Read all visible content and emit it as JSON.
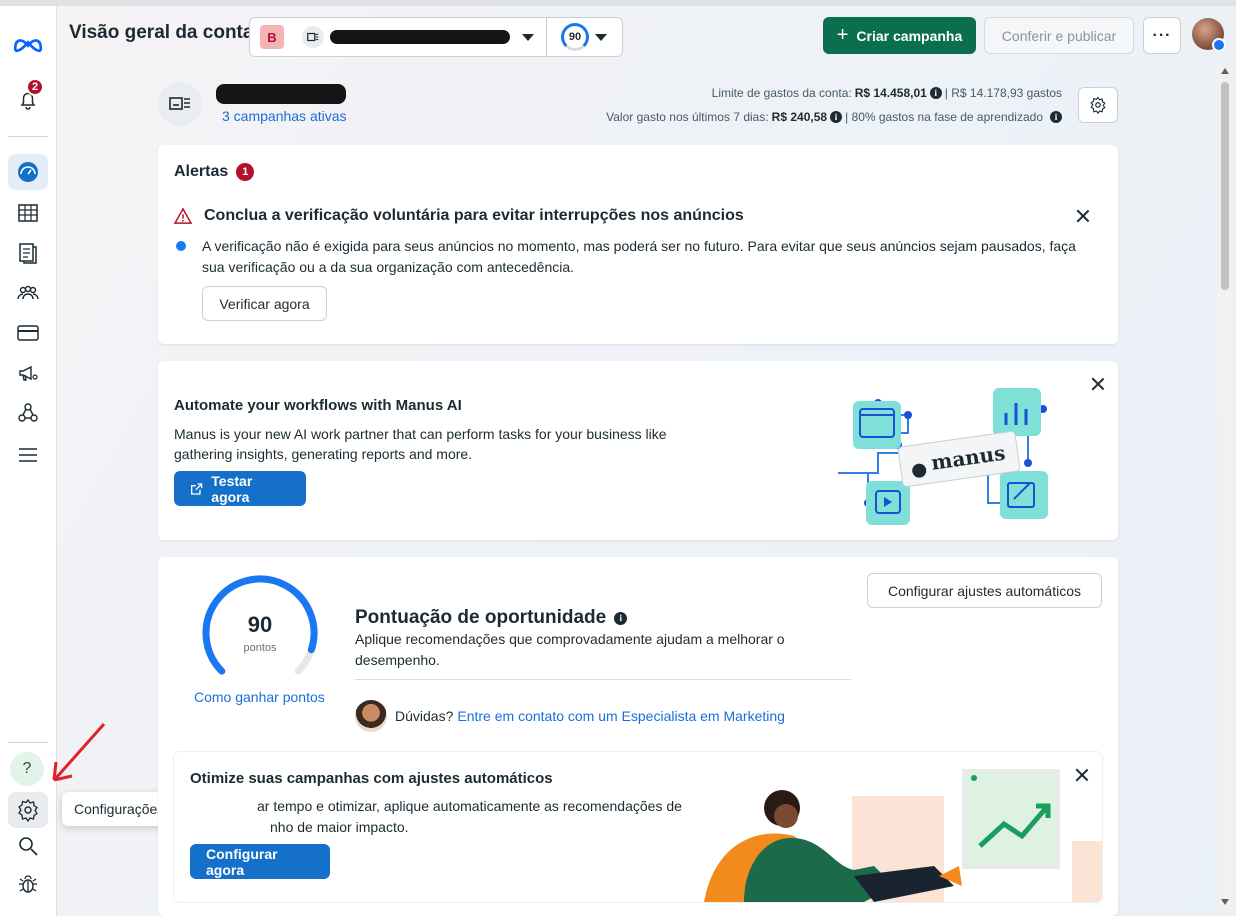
{
  "header": {
    "title": "Visão geral da conta",
    "account_badge": "B",
    "score": "90",
    "create_label": "Criar campanha",
    "review_label": "Conferir e publicar",
    "more_label": "···"
  },
  "sidebar": {
    "notification_count": "2",
    "help_label": "?",
    "tooltip": "Configurações da empresa"
  },
  "account": {
    "campaigns_link": "3 campanhas ativas",
    "limit_label": "Limite de gastos da conta:",
    "limit_value": "R$ 14.458,01",
    "limit_spent": "| R$ 14.178,93 gastos",
    "spent7_label": "Valor gasto nos últimos 7 dias:",
    "spent7_value": "R$ 240,58",
    "learning": "| 80% gastos na fase de aprendizado"
  },
  "alerts": {
    "title": "Alertas",
    "count": "1",
    "heading": "Conclua a verificação voluntária para evitar interrupções nos anúncios",
    "body": "A verificação não é exigida para seus anúncios no momento, mas poderá ser no futuro. Para evitar que seus anúncios sejam pausados, faça sua verificação ou a da sua organização com antecedência.",
    "button": "Verificar agora"
  },
  "promo": {
    "title": "Automate your workflows with Manus AI",
    "body": "Manus is your new AI work partner that can perform tasks for your business like gathering insights, generating reports and more.",
    "button": "Testar agora",
    "logo_text": "manus"
  },
  "opportunity": {
    "score": 90,
    "score_max": 100,
    "score_text": "90",
    "unit": "pontos",
    "earn_link": "Como ganhar pontos",
    "title": "Pontuação de oportunidade",
    "body": "Aplique recomendações que comprovadamente ajudam a melhorar o desempenho.",
    "auto_button": "Configurar ajustes automáticos",
    "doubts": "Dúvidas?",
    "expert_link": "Entre em contato com um Especialista em Marketing"
  },
  "optimize": {
    "title": "Otimize suas campanhas com ajustes automáticos",
    "body_visible": "ar tempo e otimizar, aplique automaticamente as recomendações de",
    "body_line2": "nho de maior impacto.",
    "button": "Configurar agora"
  },
  "colors": {
    "brand_green": "#0a6e4f",
    "accent_blue": "#1470c8",
    "alert_red": "#b3122a"
  }
}
